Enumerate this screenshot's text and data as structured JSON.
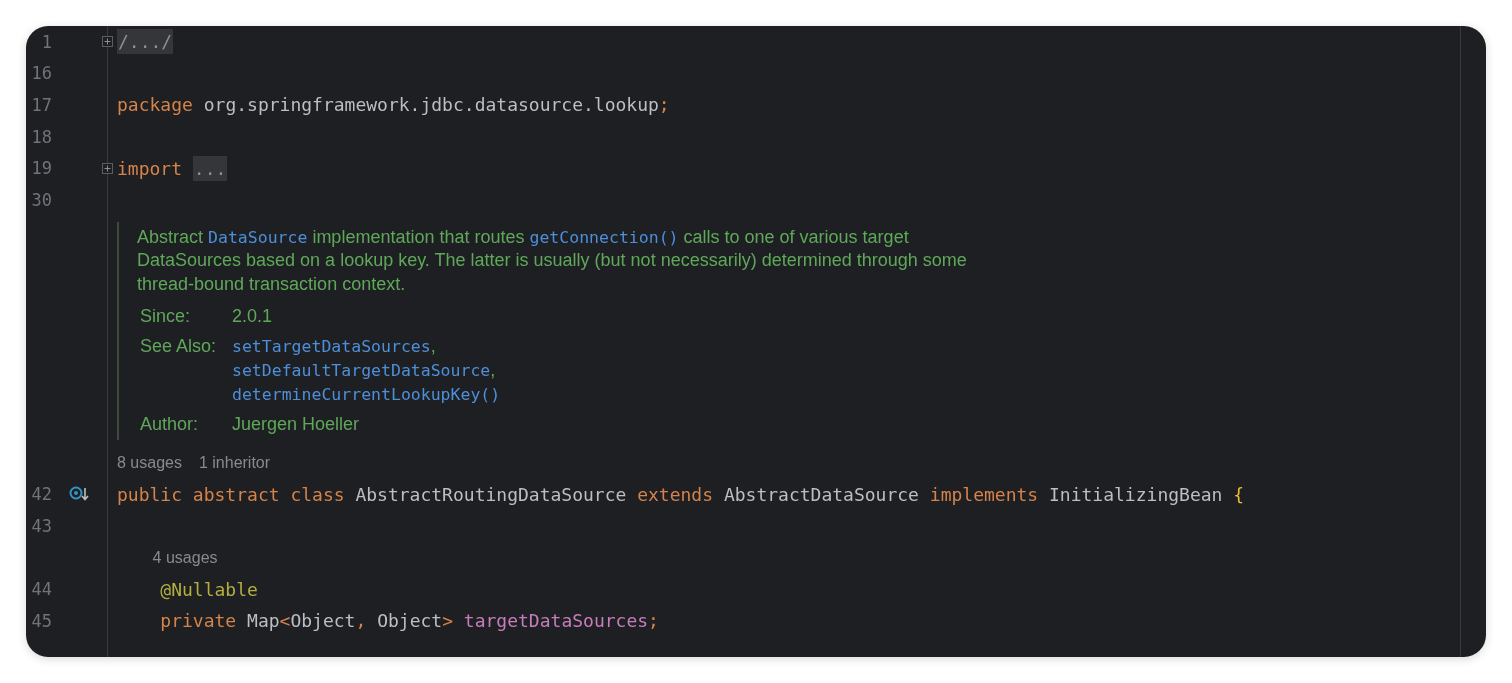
{
  "editor": {
    "lines": [
      {
        "kind": "code",
        "number": "1",
        "fold_marker": true,
        "gutter_icon": false,
        "tokens": [
          {
            "kind": "folded",
            "text": "/.../"
          }
        ]
      },
      {
        "kind": "code",
        "number": "16",
        "fold_marker": false,
        "gutter_icon": false
      },
      {
        "kind": "code",
        "number": "17",
        "fold_marker": false,
        "gutter_icon": false,
        "tokens": [
          {
            "kind": "keyword",
            "text": "package "
          },
          {
            "kind": "ident",
            "text": "org.springframework.jdbc.datasource.lookup"
          },
          {
            "kind": "punct",
            "text": ";"
          }
        ]
      },
      {
        "kind": "code",
        "number": "18",
        "fold_marker": false,
        "gutter_icon": false
      },
      {
        "kind": "code",
        "number": "19",
        "fold_marker": true,
        "gutter_icon": false,
        "tokens": [
          {
            "kind": "keyword",
            "text": "import "
          },
          {
            "kind": "folded",
            "text": "..."
          }
        ]
      },
      {
        "kind": "code",
        "number": "30",
        "fold_marker": false,
        "gutter_icon": false
      },
      {
        "kind": "doc",
        "paragraph": [
          [
            {
              "kind": "text",
              "text": "Abstract "
            },
            {
              "kind": "code",
              "text": "DataSource"
            },
            {
              "kind": "text",
              "text": " implementation that routes "
            },
            {
              "kind": "code",
              "text": "getConnection()"
            },
            {
              "kind": "text",
              "text": " calls to one of various target"
            }
          ],
          [
            {
              "kind": "text",
              "text": "DataSources based on a lookup key. The latter is usually (but not necessarily) determined through some"
            }
          ],
          [
            {
              "kind": "text",
              "text": "thread-bound transaction context."
            }
          ]
        ],
        "tags": [
          {
            "label": "Since:",
            "values": [
              [
                {
                  "kind": "text",
                  "text": "2.0.1"
                }
              ]
            ]
          },
          {
            "label": "See Also:",
            "values": [
              [
                {
                  "kind": "code",
                  "text": "setTargetDataSources"
                },
                {
                  "kind": "text",
                  "text": ","
                }
              ],
              [
                {
                  "kind": "code",
                  "text": "setDefaultTargetDataSource"
                },
                {
                  "kind": "text",
                  "text": ","
                }
              ],
              [
                {
                  "kind": "code",
                  "text": "determineCurrentLookupKey()"
                }
              ]
            ]
          },
          {
            "label": "Author:",
            "values": [
              [
                {
                  "kind": "text",
                  "text": "Juergen Hoeller"
                }
              ]
            ]
          }
        ]
      },
      {
        "kind": "hint",
        "items": [
          "8 usages",
          "1 inheritor"
        ]
      },
      {
        "kind": "code",
        "number": "42",
        "fold_marker": false,
        "gutter_icon": true,
        "tokens": [
          {
            "kind": "keyword",
            "text": "public abstract class "
          },
          {
            "kind": "ident",
            "text": "AbstractRoutingDataSource "
          },
          {
            "kind": "keyword",
            "text": "extends "
          },
          {
            "kind": "ident",
            "text": "AbstractDataSource "
          },
          {
            "kind": "keyword",
            "text": "implements "
          },
          {
            "kind": "ident",
            "text": "InitializingBean "
          },
          {
            "kind": "brace",
            "text": "{"
          }
        ],
        "children": [
          {
            "kind": "code",
            "number": "43",
            "fold_marker": false,
            "gutter_icon": false
          },
          {
            "kind": "hint",
            "items": [
              "4 usages"
            ]
          },
          {
            "kind": "code",
            "number": "44",
            "fold_marker": false,
            "gutter_icon": false,
            "tokens": [
              {
                "kind": "annotation",
                "text": "@Nullable"
              }
            ]
          },
          {
            "kind": "code",
            "number": "45",
            "fold_marker": false,
            "gutter_icon": false,
            "tokens": [
              {
                "kind": "keyword",
                "text": "private "
              },
              {
                "kind": "ident",
                "text": "Map"
              },
              {
                "kind": "punct",
                "text": "<"
              },
              {
                "kind": "ident",
                "text": "Object"
              },
              {
                "kind": "punct",
                "text": ", "
              },
              {
                "kind": "ident",
                "text": "Object"
              },
              {
                "kind": "punct",
                "text": "> "
              },
              {
                "kind": "field",
                "text": "targetDataSources"
              },
              {
                "kind": "punct",
                "text": ";"
              }
            ]
          }
        ]
      }
    ]
  }
}
